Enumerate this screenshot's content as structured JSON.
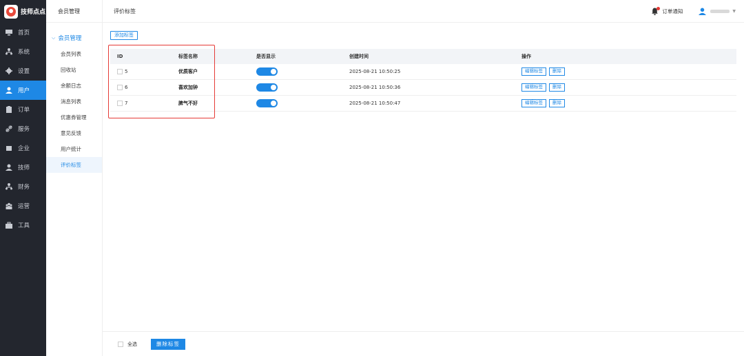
{
  "brand": {
    "name": "技师点点"
  },
  "sidebar": {
    "items": [
      {
        "label": "首页",
        "icon": "monitor-icon"
      },
      {
        "label": "系统",
        "icon": "sitemap-icon"
      },
      {
        "label": "设置",
        "icon": "gear-icon"
      },
      {
        "label": "用户",
        "icon": "user-icon",
        "active": true
      },
      {
        "label": "订单",
        "icon": "clipboard-icon"
      },
      {
        "label": "服务",
        "icon": "link-icon"
      },
      {
        "label": "企业",
        "icon": "building-icon"
      },
      {
        "label": "技师",
        "icon": "user-icon"
      },
      {
        "label": "财务",
        "icon": "sitemap-icon"
      },
      {
        "label": "运营",
        "icon": "group-icon"
      },
      {
        "label": "工具",
        "icon": "toolbox-icon"
      }
    ]
  },
  "submenu": {
    "title": "会员管理",
    "group": "会员管理",
    "items": [
      "会员列表",
      "回收站",
      "余额日志",
      "消息列表",
      "优惠券管理",
      "意见反馈",
      "用户统计",
      "评价标签"
    ]
  },
  "topbar": {
    "breadcrumb": "评价标签",
    "notify": "订单通知"
  },
  "toolbar": {
    "add_label": "添加标签"
  },
  "table": {
    "headers": [
      "ID",
      "标签名称",
      "是否显示",
      "创建时间",
      "操作"
    ],
    "rows": [
      {
        "id": "5",
        "name": "优质客户",
        "time": "2025-08-21 10:50:25",
        "show": true
      },
      {
        "id": "6",
        "name": "喜欢加钟",
        "time": "2025-08-21 10:50:36",
        "show": true
      },
      {
        "id": "7",
        "name": "脾气不好",
        "time": "2025-08-21 10:50:47",
        "show": true
      }
    ],
    "edit_label": "编辑标签",
    "delete_label": "删除"
  },
  "footer": {
    "select_all": "全选",
    "delete_tags": "删除标签"
  },
  "colors": {
    "accent": "#1e88e5",
    "sidebar_bg": "#23262e",
    "highlight": "#e53935"
  }
}
